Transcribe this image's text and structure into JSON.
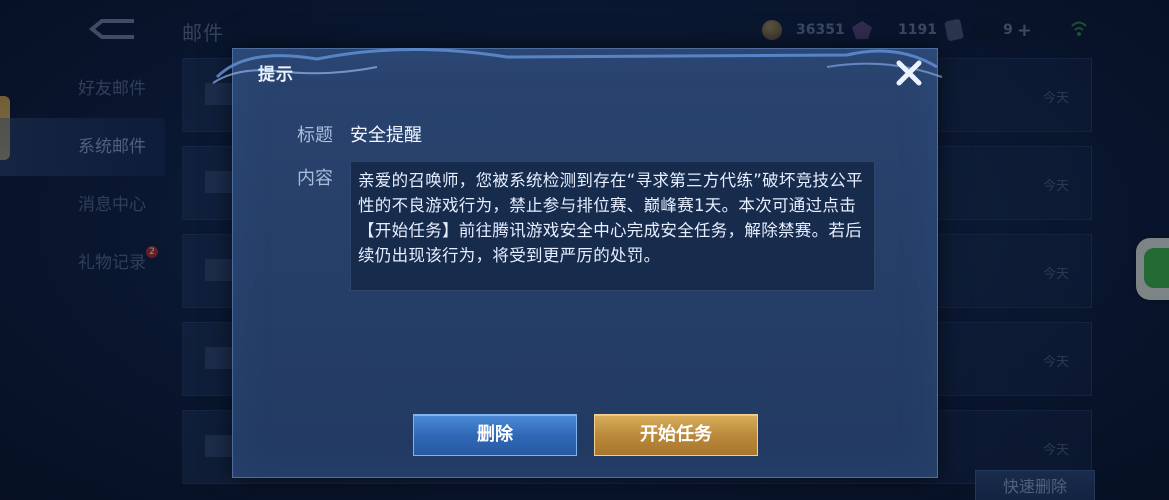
{
  "background": {
    "page_title": "邮件",
    "nav_items": [
      {
        "label": "好友邮件",
        "active": false
      },
      {
        "label": "系统邮件",
        "active": true
      },
      {
        "label": "消息中心",
        "active": false
      },
      {
        "label": "礼物记录",
        "active": false,
        "badge": "2"
      }
    ],
    "currency": {
      "coin": "36351",
      "gem": "1191",
      "ticket": "9"
    },
    "mail_rows": [
      {
        "date": "今天"
      },
      {
        "date": "今天"
      },
      {
        "date": "今天"
      },
      {
        "date": "今天"
      },
      {
        "date": "今天"
      }
    ],
    "quick_delete_label": "快速删除"
  },
  "dialog": {
    "title": "提示",
    "title_label": "标题",
    "title_value": "安全提醒",
    "content_label": "内容",
    "content_text": "亲爱的召唤师，您被系统检测到存在“寻求第三方代练”破坏竞技公平性的不良游戏行为，禁止参与排位赛、巅峰赛1天。本次可通过点击【开始任务】前往腾讯游戏安全中心完成安全任务，解除禁赛。若后续仍出现该行为，将受到更严厉的处罚。",
    "delete_button": "删除",
    "start_task_button": "开始任务"
  },
  "colors": {
    "delete_button": "#2f66b4",
    "start_button": "#b8873a",
    "dialog_bg": "#26406a"
  }
}
